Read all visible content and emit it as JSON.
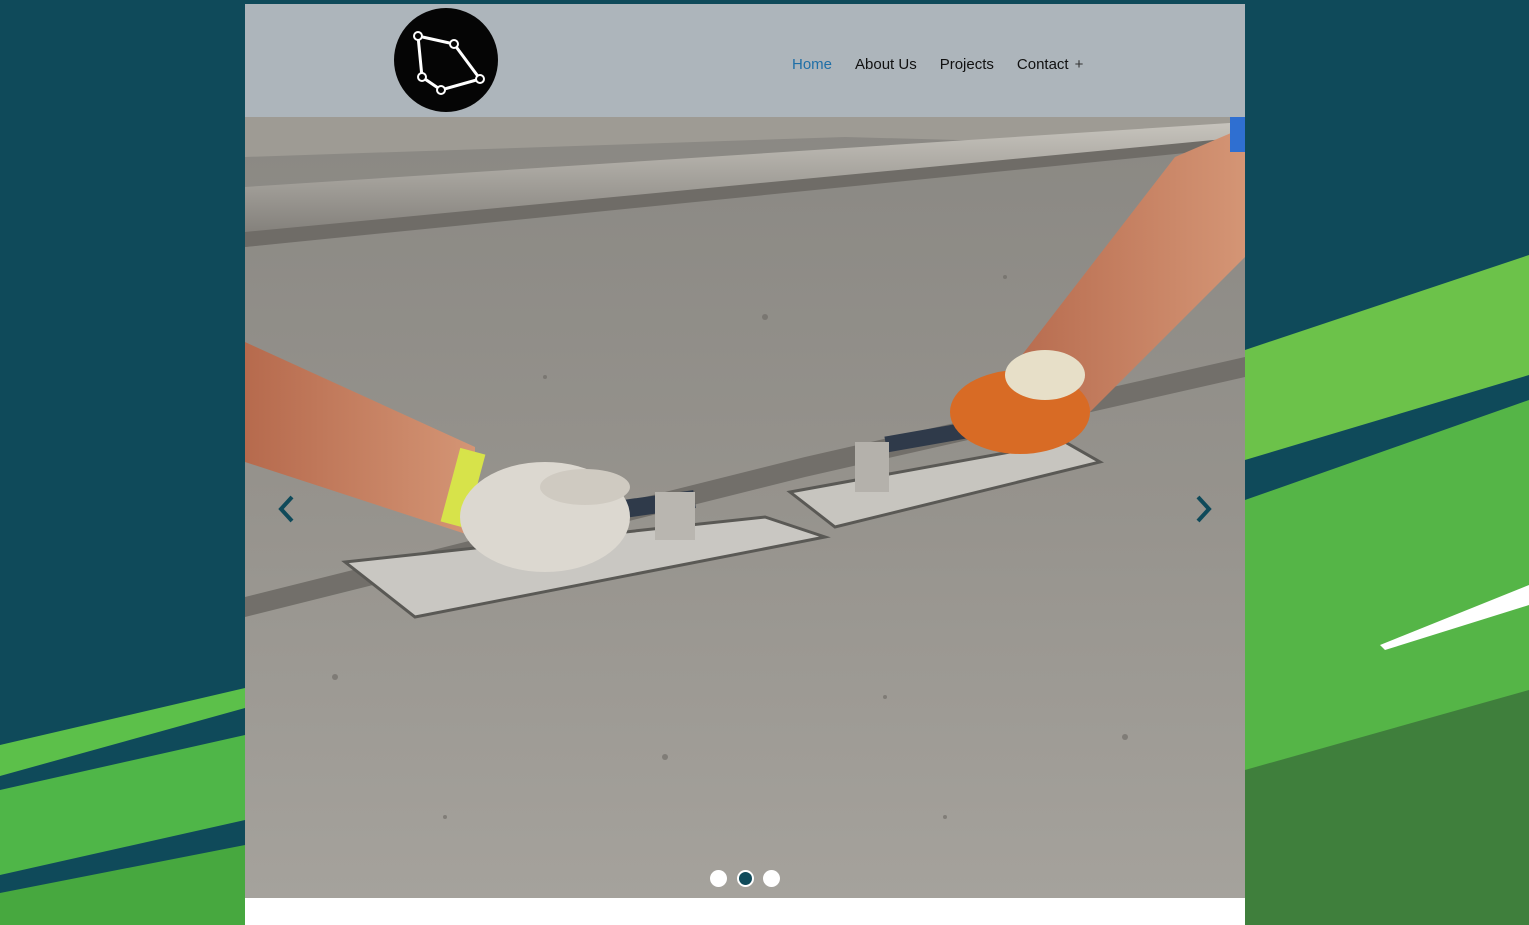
{
  "page": {
    "colors": {
      "background": "#0f4a5a",
      "accent_green": "#4fb648",
      "header": "#adb5bb",
      "nav_active": "#1f6fa7",
      "nav_text": "#111111"
    }
  },
  "header": {
    "logo_icon": "polygon-constellation-logo-icon",
    "nav": {
      "home": "Home",
      "about": "About Us",
      "projects": "Projects",
      "contact": "Contact",
      "contact_expand": "+"
    }
  },
  "slider": {
    "image_description_icon": "concrete-trowel-photo",
    "prev_icon": "chevron-left-icon",
    "next_icon": "chevron-right-icon",
    "slide_count": 3,
    "active_slide": 2
  }
}
